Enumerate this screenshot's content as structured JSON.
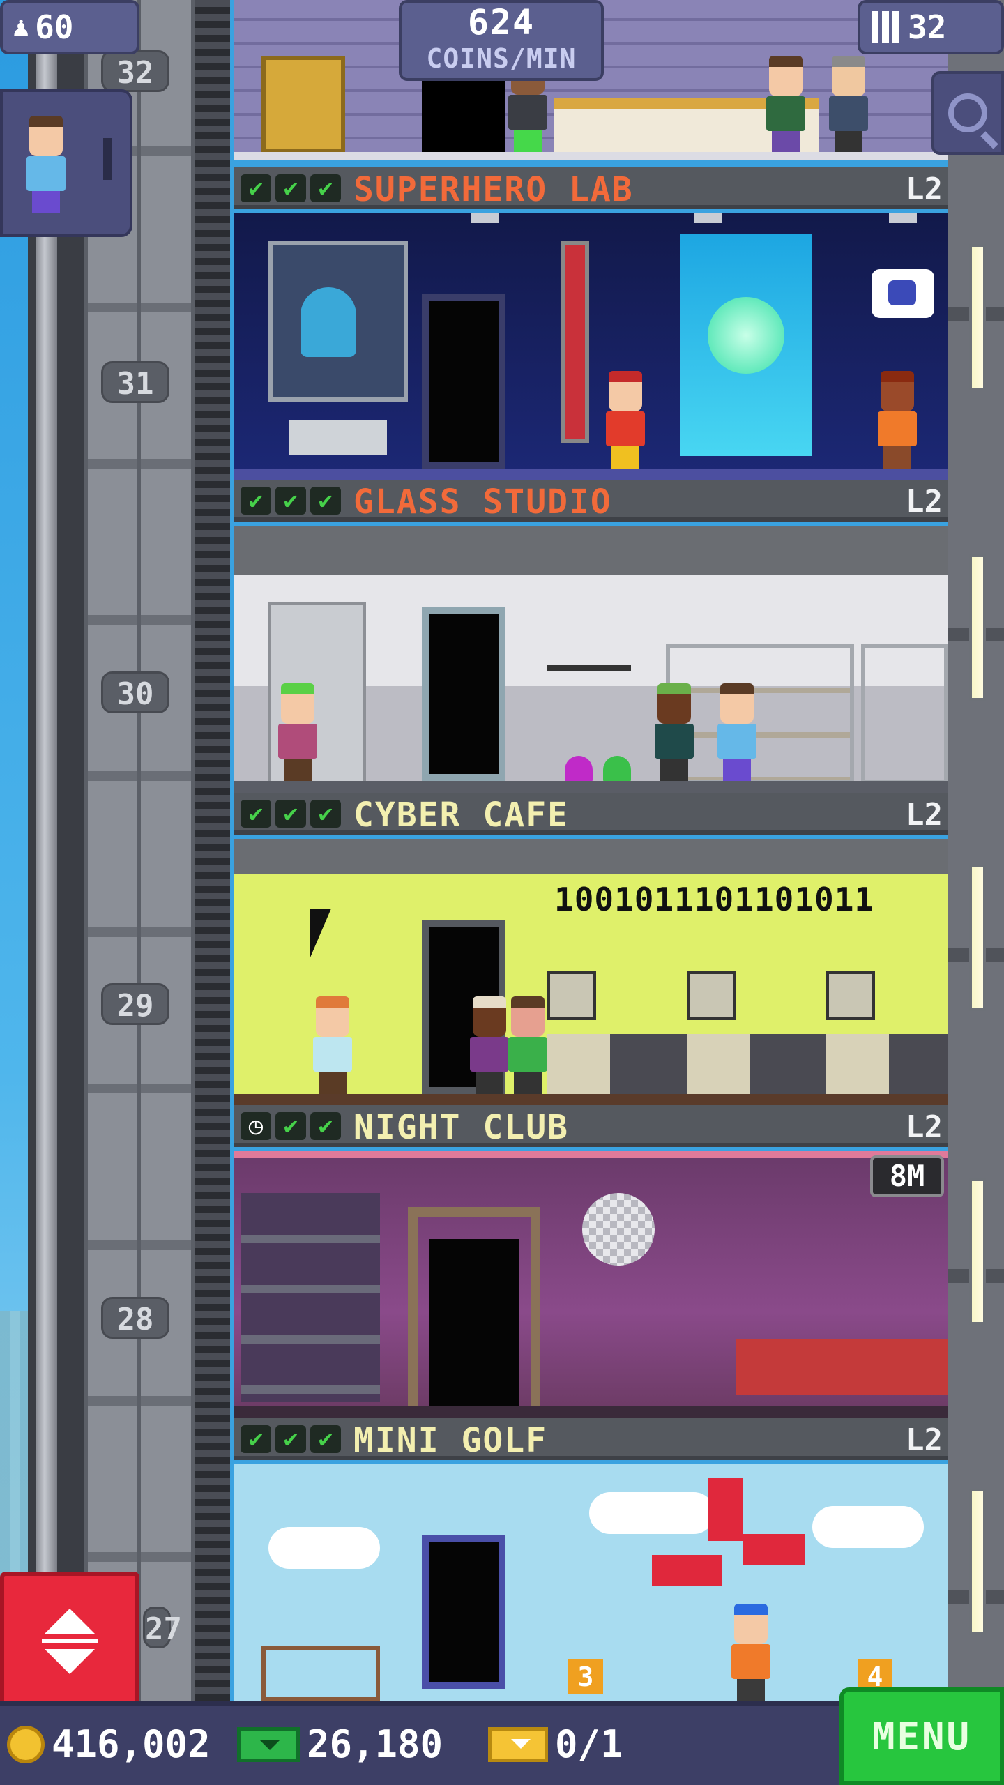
{
  "hud": {
    "population": "60",
    "coins_per_min": "624",
    "coins_per_min_unit": "COINS/MIN",
    "floor_count": "32"
  },
  "floors": [
    {
      "number": "32"
    },
    {
      "number": "31",
      "name": "SUPERHERO LAB",
      "level": "L2",
      "name_color": "#f26a3a",
      "checks": [
        "check",
        "check",
        "check"
      ]
    },
    {
      "number": "30",
      "name": "GLASS STUDIO",
      "level": "L2",
      "name_color": "#f26a3a",
      "checks": [
        "check",
        "check",
        "check"
      ]
    },
    {
      "number": "29",
      "name": "CYBER CAFE",
      "level": "L2",
      "name_color": "#f3efb0",
      "checks": [
        "check",
        "check",
        "check"
      ],
      "wall_text": "1001011101101011"
    },
    {
      "number": "28",
      "name": "NIGHT CLUB",
      "level": "L2",
      "name_color": "#f3efb0",
      "checks": [
        "clock",
        "check",
        "check"
      ],
      "timer": "8M"
    },
    {
      "number": "27",
      "name": "MINI GOLF",
      "level": "L2",
      "name_color": "#f3efb0",
      "checks": [
        "check",
        "check",
        "check"
      ],
      "hole_a": "3",
      "hole_b": "4"
    }
  ],
  "bottom_bar": {
    "coins": "416,002",
    "bux": "26,180",
    "tickets": "0/1",
    "menu_label": "MENU"
  },
  "icons": {
    "population": "person-icon",
    "floors": "building-icon",
    "coins": "coin-icon",
    "bux": "bux-icon",
    "tickets": "ticket-icon",
    "search": "magnifier-icon",
    "elevator": "elevator-arrows-icon",
    "check": "check-icon",
    "clock": "clock-icon"
  },
  "colors": {
    "check": "#46d14a",
    "menu": "#27c63e",
    "elevator_button": "#e8283c",
    "hud_panel": "#5b5f8f"
  }
}
